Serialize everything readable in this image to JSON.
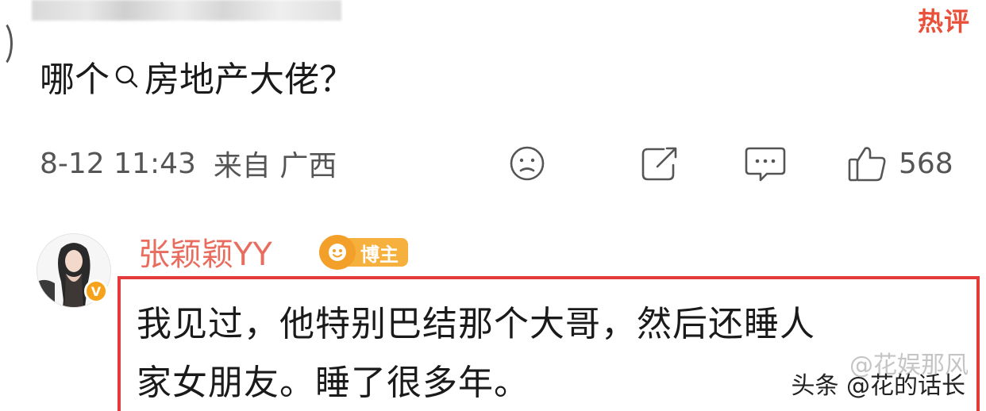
{
  "post": {
    "hot_tag": "热评",
    "title_before": "哪个",
    "title_link": "房地产大佬",
    "title_after": "？",
    "timestamp": "8-12 11:43",
    "source": "来自 广西",
    "like_count": "568"
  },
  "reply": {
    "username": "张颖颖YY",
    "owner_badge": "博主",
    "avatar_badge": "V",
    "line1": "我见过，他特别巴结那个大哥，然后还睡人",
    "line2": "家女朋友。睡了很多年。"
  },
  "watermark": {
    "text": "头条 @花的话长",
    "ghost_text": "@花娱那风"
  },
  "colors": {
    "username": "#e86d5e",
    "highlight_border": "#e33b3b",
    "badge": "#f6b03d",
    "hot_tag": "#e8503a"
  }
}
